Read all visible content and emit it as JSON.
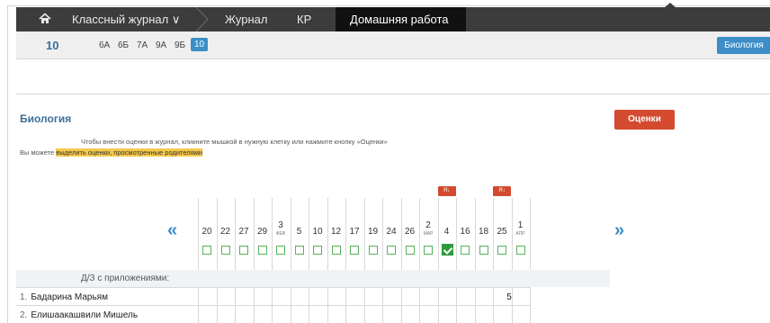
{
  "nav": {
    "items": [
      "Классный журнал",
      "Журнал",
      "КР"
    ],
    "active": "Домашняя работа",
    "dropdown_glyph": "∨"
  },
  "class_bar": {
    "current": "10",
    "classes": [
      "6А",
      "6Б",
      "7А",
      "9А",
      "9Б",
      "10"
    ],
    "selected": "10",
    "subject_button": "Биология"
  },
  "page": {
    "title": "Биология",
    "marks_button": "Оценки",
    "hint_line1": "Чтобы внести оценки в журнал, кликните мышкой в нужную клетку или нажмите кнопку «Оценки»",
    "hint_line2_prefix": "Вы можете ",
    "hint_line2_link": "выделить оценки, просмотренные родителями"
  },
  "journal": {
    "dates": [
      {
        "day": "20",
        "mon": ""
      },
      {
        "day": "22",
        "mon": ""
      },
      {
        "day": "27",
        "mon": ""
      },
      {
        "day": "29",
        "mon": ""
      },
      {
        "day": "3",
        "mon": "ФЕВ"
      },
      {
        "day": "5",
        "mon": ""
      },
      {
        "day": "10",
        "mon": ""
      },
      {
        "day": "12",
        "mon": ""
      },
      {
        "day": "17",
        "mon": ""
      },
      {
        "day": "19",
        "mon": ""
      },
      {
        "day": "24",
        "mon": ""
      },
      {
        "day": "26",
        "mon": ""
      },
      {
        "day": "2",
        "mon": "МАР"
      },
      {
        "day": "4",
        "mon": ""
      },
      {
        "day": "16",
        "mon": ""
      },
      {
        "day": "18",
        "mon": ""
      },
      {
        "day": "25",
        "mon": ""
      },
      {
        "day": "1",
        "mon": "АПР"
      }
    ],
    "checked_index": 13,
    "tags": [
      {
        "index": 13,
        "label": "Я↓"
      },
      {
        "index": 16,
        "label": "Я↓"
      }
    ],
    "homework_row_label": "Д/З с приложениями:",
    "attachment_indices": [
      13,
      16
    ],
    "students": [
      {
        "num": "1.",
        "name": "Бадарина Марьям",
        "grade": "5"
      },
      {
        "num": "2.",
        "name": "Елишаакашвили Мишель",
        "grade": ""
      }
    ]
  },
  "colors": {
    "accent": "#3b8ec8",
    "danger": "#d34a2e",
    "success": "#2e9a3e",
    "highlight": "#f5c84a",
    "nav_bg": "#3c3c3c"
  }
}
